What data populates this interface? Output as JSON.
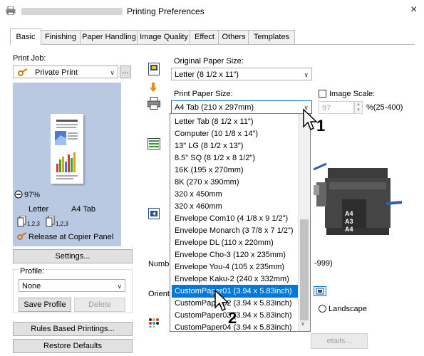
{
  "window": {
    "title": "Printing Preferences",
    "close_glyph": "×"
  },
  "tabs": [
    {
      "label": "Basic",
      "active": true
    },
    {
      "label": "Finishing"
    },
    {
      "label": "Paper Handling"
    },
    {
      "label": "Image Quality"
    },
    {
      "label": "Effect"
    },
    {
      "label": "Others"
    },
    {
      "label": "Templates"
    }
  ],
  "left": {
    "print_job_label": "Print Job:",
    "print_job_value": "Private Print",
    "more_button": "...",
    "zoom": "97%",
    "orig_size": "Letter",
    "print_size": "A4 Tab",
    "copies_a": "1,2,3",
    "copies_b": "1,2,3",
    "release_text": "Release at Copier Panel",
    "settings_button": "Settings...",
    "profile_label": "Profile:",
    "profile_value": "None",
    "save_profile_button": "Save Profile",
    "delete_button": "Delete",
    "rules_button": "Rules Based Printings...",
    "restore_button": "Restore Defaults"
  },
  "main": {
    "original_size_label": "Original Paper Size:",
    "original_size_value": "Letter (8 1/2 x 11\")",
    "print_size_label": "Print Paper Size:",
    "print_size_value": "A4 Tab (210 x 297mm)",
    "image_scale_label": "Image Scale:",
    "image_scale_value": "97",
    "image_scale_range": "%(25-400)",
    "number_label_partial": "Numb",
    "copies_range_partial": "-999)",
    "orientation_label_partial": "Orient",
    "landscape_label": "Landscape",
    "details_button_partial": "etails...",
    "tray_labels": [
      "A4",
      "A3",
      "A4"
    ]
  },
  "paper_list": {
    "items": [
      "Letter Tab (8 1/2 x 11\")",
      "Computer (10 1/8 x 14\")",
      "13\" LG (8 1/2 x 13\")",
      "8.5\" SQ (8 1/2 x 8 1/2\")",
      "16K (195 x 270mm)",
      "8K (270 x 390mm)",
      "320 x 450mm",
      "320 x 460mm",
      "Envelope Com10 (4 1/8 x 9 1/2\")",
      "Envelope Monarch (3 7/8 x 7 1/2\")",
      "Envelope DL (110 x 220mm)",
      "Envelope Cho-3 (120 x 235mm)",
      "Envelope You-4 (105 x 235mm)",
      "Envelope Kaku-2 (240 x 332mm)",
      "CustomPaper01 (3.94 x 5.83inch)",
      "CustomPaper02 (3.94 x 5.83inch)",
      "CustomPaper03 (3.94 x 5.83inch)",
      "CustomPaper04 (3.94 x 5.83inch)"
    ],
    "selected_index": 14
  },
  "callouts": {
    "one": "1",
    "two": "2"
  },
  "colors": {
    "selection": "#0078d7",
    "preview_bg": "#b9c9e1",
    "accent_arrow": "#2f5fb3"
  }
}
